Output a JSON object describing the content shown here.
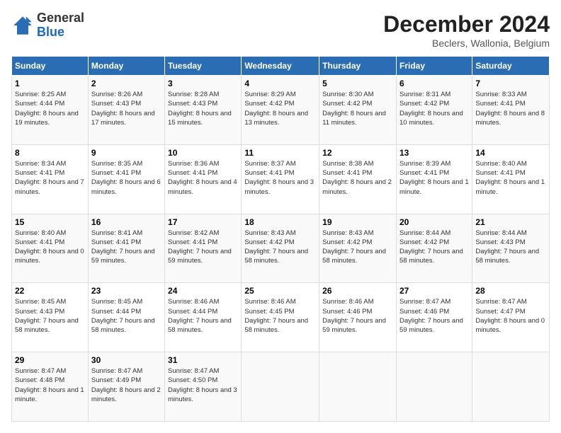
{
  "logo": {
    "general": "General",
    "blue": "Blue"
  },
  "header": {
    "title": "December 2024",
    "subtitle": "Beclers, Wallonia, Belgium"
  },
  "columns": [
    "Sunday",
    "Monday",
    "Tuesday",
    "Wednesday",
    "Thursday",
    "Friday",
    "Saturday"
  ],
  "weeks": [
    [
      {
        "day": "1",
        "sunrise": "8:25 AM",
        "sunset": "4:44 PM",
        "daylight": "8 hours and 19 minutes."
      },
      {
        "day": "2",
        "sunrise": "8:26 AM",
        "sunset": "4:43 PM",
        "daylight": "8 hours and 17 minutes."
      },
      {
        "day": "3",
        "sunrise": "8:28 AM",
        "sunset": "4:43 PM",
        "daylight": "8 hours and 15 minutes."
      },
      {
        "day": "4",
        "sunrise": "8:29 AM",
        "sunset": "4:42 PM",
        "daylight": "8 hours and 13 minutes."
      },
      {
        "day": "5",
        "sunrise": "8:30 AM",
        "sunset": "4:42 PM",
        "daylight": "8 hours and 11 minutes."
      },
      {
        "day": "6",
        "sunrise": "8:31 AM",
        "sunset": "4:42 PM",
        "daylight": "8 hours and 10 minutes."
      },
      {
        "day": "7",
        "sunrise": "8:33 AM",
        "sunset": "4:41 PM",
        "daylight": "8 hours and 8 minutes."
      }
    ],
    [
      {
        "day": "8",
        "sunrise": "8:34 AM",
        "sunset": "4:41 PM",
        "daylight": "8 hours and 7 minutes."
      },
      {
        "day": "9",
        "sunrise": "8:35 AM",
        "sunset": "4:41 PM",
        "daylight": "8 hours and 6 minutes."
      },
      {
        "day": "10",
        "sunrise": "8:36 AM",
        "sunset": "4:41 PM",
        "daylight": "8 hours and 4 minutes."
      },
      {
        "day": "11",
        "sunrise": "8:37 AM",
        "sunset": "4:41 PM",
        "daylight": "8 hours and 3 minutes."
      },
      {
        "day": "12",
        "sunrise": "8:38 AM",
        "sunset": "4:41 PM",
        "daylight": "8 hours and 2 minutes."
      },
      {
        "day": "13",
        "sunrise": "8:39 AM",
        "sunset": "4:41 PM",
        "daylight": "8 hours and 1 minute."
      },
      {
        "day": "14",
        "sunrise": "8:40 AM",
        "sunset": "4:41 PM",
        "daylight": "8 hours and 1 minute."
      }
    ],
    [
      {
        "day": "15",
        "sunrise": "8:40 AM",
        "sunset": "4:41 PM",
        "daylight": "8 hours and 0 minutes."
      },
      {
        "day": "16",
        "sunrise": "8:41 AM",
        "sunset": "4:41 PM",
        "daylight": "7 hours and 59 minutes."
      },
      {
        "day": "17",
        "sunrise": "8:42 AM",
        "sunset": "4:41 PM",
        "daylight": "7 hours and 59 minutes."
      },
      {
        "day": "18",
        "sunrise": "8:43 AM",
        "sunset": "4:42 PM",
        "daylight": "7 hours and 58 minutes."
      },
      {
        "day": "19",
        "sunrise": "8:43 AM",
        "sunset": "4:42 PM",
        "daylight": "7 hours and 58 minutes."
      },
      {
        "day": "20",
        "sunrise": "8:44 AM",
        "sunset": "4:42 PM",
        "daylight": "7 hours and 58 minutes."
      },
      {
        "day": "21",
        "sunrise": "8:44 AM",
        "sunset": "4:43 PM",
        "daylight": "7 hours and 58 minutes."
      }
    ],
    [
      {
        "day": "22",
        "sunrise": "8:45 AM",
        "sunset": "4:43 PM",
        "daylight": "7 hours and 58 minutes."
      },
      {
        "day": "23",
        "sunrise": "8:45 AM",
        "sunset": "4:44 PM",
        "daylight": "7 hours and 58 minutes."
      },
      {
        "day": "24",
        "sunrise": "8:46 AM",
        "sunset": "4:44 PM",
        "daylight": "7 hours and 58 minutes."
      },
      {
        "day": "25",
        "sunrise": "8:46 AM",
        "sunset": "4:45 PM",
        "daylight": "7 hours and 58 minutes."
      },
      {
        "day": "26",
        "sunrise": "8:46 AM",
        "sunset": "4:46 PM",
        "daylight": "7 hours and 59 minutes."
      },
      {
        "day": "27",
        "sunrise": "8:47 AM",
        "sunset": "4:46 PM",
        "daylight": "7 hours and 59 minutes."
      },
      {
        "day": "28",
        "sunrise": "8:47 AM",
        "sunset": "4:47 PM",
        "daylight": "8 hours and 0 minutes."
      }
    ],
    [
      {
        "day": "29",
        "sunrise": "8:47 AM",
        "sunset": "4:48 PM",
        "daylight": "8 hours and 1 minute."
      },
      {
        "day": "30",
        "sunrise": "8:47 AM",
        "sunset": "4:49 PM",
        "daylight": "8 hours and 2 minutes."
      },
      {
        "day": "31",
        "sunrise": "8:47 AM",
        "sunset": "4:50 PM",
        "daylight": "8 hours and 3 minutes."
      },
      null,
      null,
      null,
      null
    ]
  ]
}
